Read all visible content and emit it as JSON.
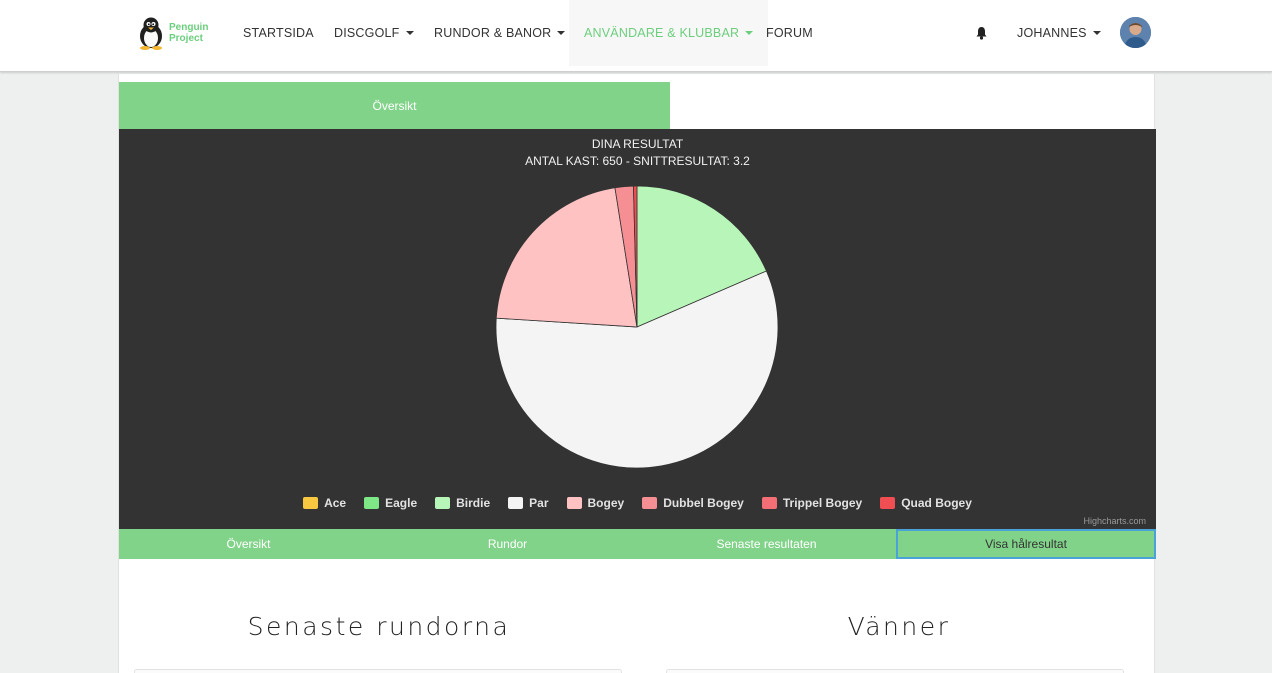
{
  "brand": {
    "name": "Penguin\nProject"
  },
  "nav": {
    "items": [
      {
        "label": "STARTSIDA",
        "dropdown": false
      },
      {
        "label": "DISCGOLF",
        "dropdown": true
      },
      {
        "label": "RUNDOR & BANOR",
        "dropdown": true
      },
      {
        "label": "ANVÄNDARE & KLUBBAR",
        "dropdown": true,
        "active": true
      },
      {
        "label": "FORUM",
        "dropdown": false
      }
    ],
    "notifications_icon": "bell-icon",
    "user": {
      "label": "JOHANNES",
      "avatar_icon": "user-avatar"
    }
  },
  "top_tab": {
    "label": "Översikt"
  },
  "chart_data": {
    "type": "pie",
    "title": "DINA RESULTAT",
    "subtitle": "ANTAL KAST: 650 - SNITTRESULTAT: 3.2",
    "categories": [
      "Ace",
      "Eagle",
      "Birdie",
      "Par",
      "Bogey",
      "Dubbel Bogey",
      "Trippel Bogey",
      "Quad Bogey"
    ],
    "values": [
      0,
      0,
      18.5,
      57.5,
      21.5,
      2.1,
      0,
      0.4
    ],
    "colors": [
      "#f7c840",
      "#7ee887",
      "#b8f5b8",
      "#f4f4f4",
      "#ffc2c2",
      "#f58f93",
      "#f36f75",
      "#f04e52"
    ],
    "legend_position": "bottom",
    "credit": "Highcharts.com"
  },
  "bottom_tabs": [
    {
      "label": "Översikt"
    },
    {
      "label": "Rundor"
    },
    {
      "label": "Senaste resultaten"
    },
    {
      "label": "Visa hålresultat",
      "focused": true
    }
  ],
  "sections": {
    "left_title": "Senaste rundorna",
    "right_title": "Vänner"
  }
}
